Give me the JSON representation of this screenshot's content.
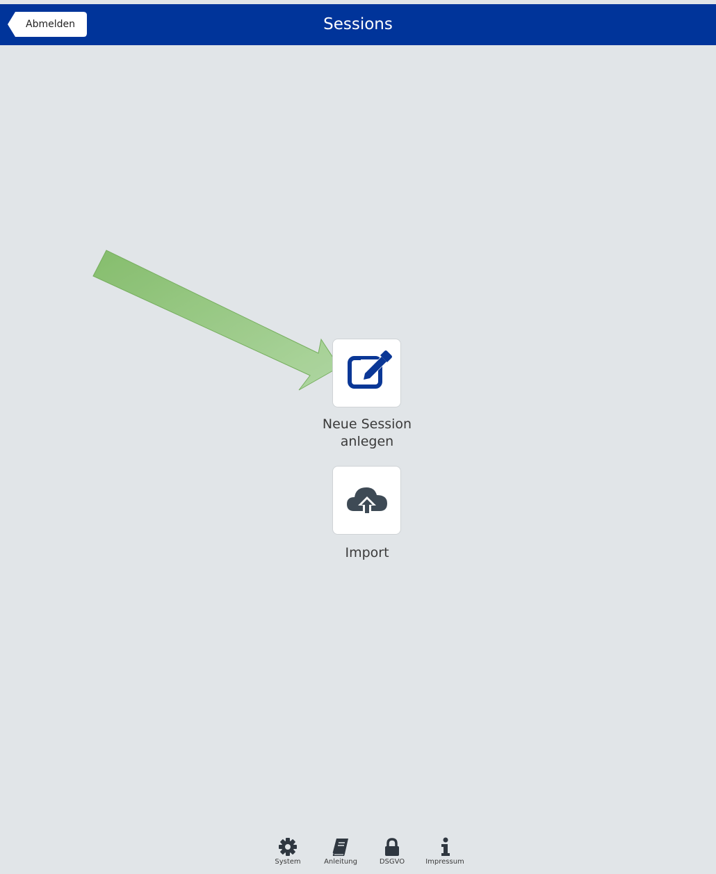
{
  "header": {
    "title": "Sessions",
    "back_label": "Abmelden"
  },
  "tiles": {
    "new_session": {
      "label_line1": "Neue Session",
      "label_line2": "anlegen",
      "icon": "edit-icon"
    },
    "import": {
      "label": "Import",
      "icon": "cloud-upload-icon"
    }
  },
  "footer": {
    "items": [
      {
        "label": "System",
        "icon": "gear-icon"
      },
      {
        "label": "Anleitung",
        "icon": "book-icon"
      },
      {
        "label": "DSGVO",
        "icon": "lock-icon"
      },
      {
        "label": "Impressum",
        "icon": "info-icon"
      }
    ]
  },
  "colors": {
    "header_bg": "#00349a",
    "page_bg": "#e1e5e8",
    "edit_icon": "#0a3796",
    "icon_dark": "#3e4a55",
    "annotation_arrow": "#9ccd82"
  }
}
